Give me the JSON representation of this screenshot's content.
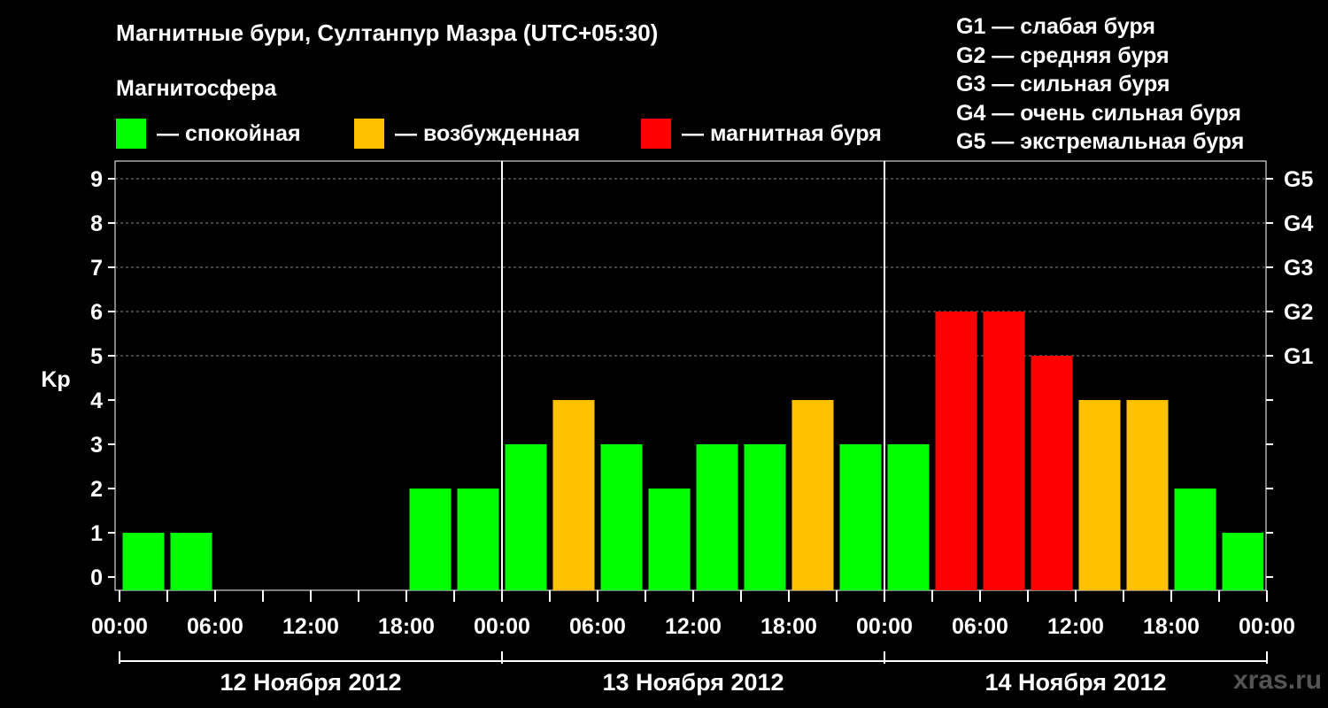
{
  "title": "Магнитные бури, Султанпур Мазра (UTC+05:30)",
  "subtitle": "Магнитосфера",
  "legend": [
    {
      "color": "#00ff00",
      "label": "— спокойная"
    },
    {
      "color": "#ffc000",
      "label": "— возбужденная"
    },
    {
      "color": "#ff0000",
      "label": "— магнитная буря"
    }
  ],
  "g_legend": [
    "G1 — слабая буря",
    "G2 — средняя буря",
    "G3 — сильная буря",
    "G4 — очень сильная буря",
    "G5 — экстремальная буря"
  ],
  "watermark": "xras.ru",
  "chart_data": {
    "type": "bar",
    "title": "Магнитные бури, Султанпур Мазра (UTC+05:30)",
    "subtitle": "Магнитосфера",
    "ylabel": "Kp",
    "ylim": [
      0,
      9
    ],
    "yticks": [
      0,
      1,
      2,
      3,
      4,
      5,
      6,
      7,
      8,
      9
    ],
    "right_ticks": [
      {
        "value": 5,
        "label": "G1"
      },
      {
        "value": 6,
        "label": "G2"
      },
      {
        "value": 7,
        "label": "G3"
      },
      {
        "value": 8,
        "label": "G4"
      },
      {
        "value": 9,
        "label": "G5"
      }
    ],
    "x_tick_labels": [
      "00:00",
      "06:00",
      "12:00",
      "18:00",
      "00:00",
      "06:00",
      "12:00",
      "18:00",
      "00:00",
      "06:00",
      "12:00",
      "18:00",
      "00:00"
    ],
    "day_labels": [
      "12 Ноября 2012",
      "13 Ноября 2012",
      "14 Ноября 2012"
    ],
    "grid_y": true,
    "categories": [
      "12.11 02:30",
      "12.11 05:30",
      "12.11 08:30",
      "12.11 11:30",
      "12.11 14:30",
      "12.11 17:30",
      "12.11 20:30",
      "12.11 23:30",
      "13.11 02:30",
      "13.11 05:30",
      "13.11 08:30",
      "13.11 11:30",
      "13.11 14:30",
      "13.11 17:30",
      "13.11 20:30",
      "13.11 23:30",
      "14.11 02:30",
      "14.11 05:30",
      "14.11 08:30",
      "14.11 11:30",
      "14.11 14:30",
      "14.11 17:30",
      "14.11 20:30",
      "14.11 23:30"
    ],
    "values": [
      1,
      1,
      0,
      0,
      0,
      0,
      2,
      2,
      3,
      4,
      3,
      2,
      3,
      3,
      4,
      3,
      3,
      6,
      6,
      5,
      4,
      4,
      2,
      1
    ],
    "colors": {
      "quiet": "#00ff00",
      "active": "#ffc000",
      "storm": "#ff0000"
    }
  }
}
